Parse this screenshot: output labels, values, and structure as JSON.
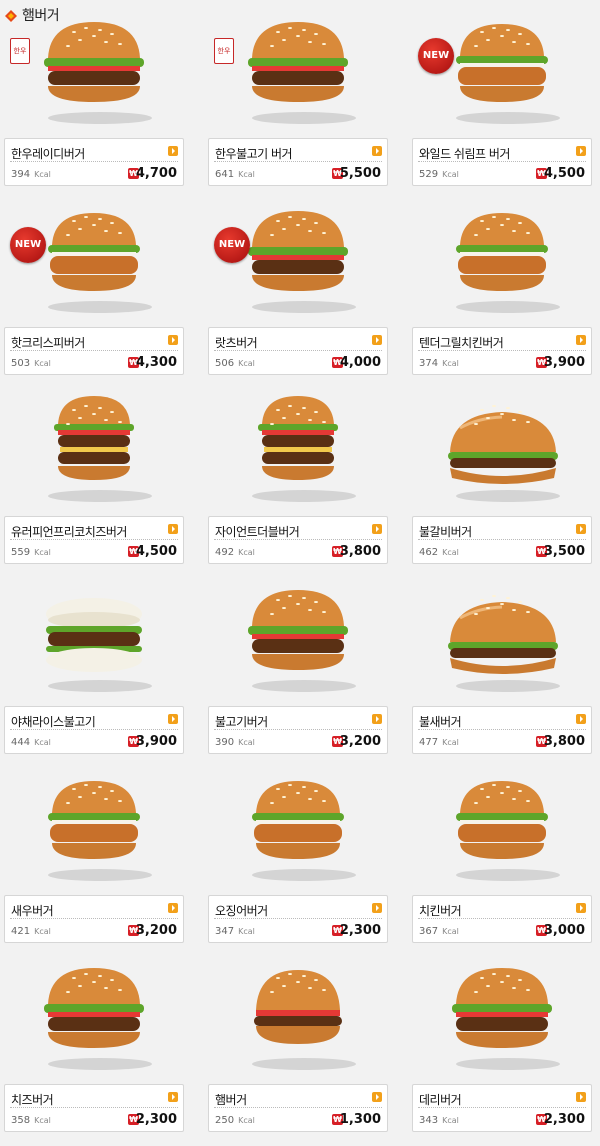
{
  "section": {
    "title": "햄버거",
    "icon": "diamond-icon"
  },
  "items": [
    {
      "name": "한우레이디버거",
      "kcal": "394",
      "price": "4,700",
      "badge": "hanwoo",
      "badge_text": "한우"
    },
    {
      "name": "한우불고기 버거",
      "kcal": "641",
      "price": "5,500",
      "badge": "hanwoo",
      "badge_text": "한우"
    },
    {
      "name": "와일드 쉬림프 버거",
      "kcal": "529",
      "price": "4,500",
      "badge": "new",
      "badge_text": "NEW"
    },
    {
      "name": "핫크리스피버거",
      "kcal": "503",
      "price": "4,300",
      "badge": "new",
      "badge_text": "NEW"
    },
    {
      "name": "랏츠버거",
      "kcal": "506",
      "price": "4,000",
      "badge": "new",
      "badge_text": "NEW"
    },
    {
      "name": "텐더그릴치킨버거",
      "kcal": "374",
      "price": "3,900",
      "badge": "",
      "badge_text": ""
    },
    {
      "name": "유러피언프리코치즈버거",
      "kcal": "559",
      "price": "4,500",
      "badge": "",
      "badge_text": ""
    },
    {
      "name": "자이언트더블버거",
      "kcal": "492",
      "price": "3,800",
      "badge": "",
      "badge_text": ""
    },
    {
      "name": "불갈비버거",
      "kcal": "462",
      "price": "3,500",
      "badge": "",
      "badge_text": ""
    },
    {
      "name": "야채라이스불고기",
      "kcal": "444",
      "price": "3,900",
      "badge": "",
      "badge_text": ""
    },
    {
      "name": "불고기버거",
      "kcal": "390",
      "price": "3,200",
      "badge": "",
      "badge_text": ""
    },
    {
      "name": "불새버거",
      "kcal": "477",
      "price": "3,800",
      "badge": "",
      "badge_text": ""
    },
    {
      "name": "새우버거",
      "kcal": "421",
      "price": "3,200",
      "badge": "",
      "badge_text": ""
    },
    {
      "name": "오징어버거",
      "kcal": "347",
      "price": "2,300",
      "badge": "",
      "badge_text": ""
    },
    {
      "name": "치킨버거",
      "kcal": "367",
      "price": "3,000",
      "badge": "",
      "badge_text": ""
    },
    {
      "name": "치즈버거",
      "kcal": "358",
      "price": "2,300",
      "badge": "",
      "badge_text": ""
    },
    {
      "name": "햄버거",
      "kcal": "250",
      "price": "1,300",
      "badge": "",
      "badge_text": ""
    },
    {
      "name": "데리버거",
      "kcal": "343",
      "price": "2,300",
      "badge": "",
      "badge_text": ""
    }
  ],
  "labels": {
    "kcal_unit": "Kcal",
    "won_symbol": "₩"
  },
  "colors": {
    "accent": "#f2a01a",
    "won_badge": "#d61f26",
    "new_badge": "#c8161d",
    "bun": "#d98a3a",
    "lettuce": "#5ea52a",
    "patty": "#5a3014"
  },
  "burger_styles": [
    "classic",
    "classic",
    "crispy",
    "crispy",
    "classic",
    "crispy",
    "double",
    "double",
    "long",
    "rice",
    "classic",
    "long",
    "crispy",
    "crispy",
    "crispy",
    "classic",
    "plain",
    "classic"
  ]
}
